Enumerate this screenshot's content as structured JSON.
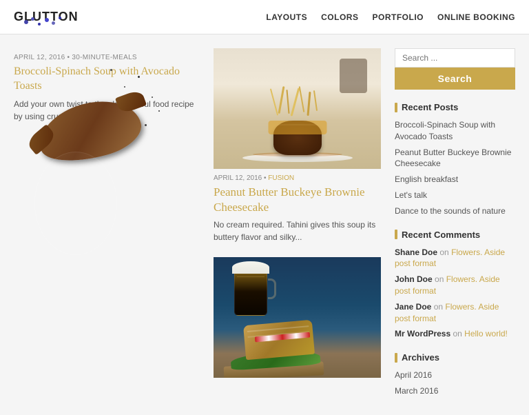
{
  "header": {
    "logo": "GLUTTON",
    "nav": [
      {
        "label": "LAYOUTS",
        "href": "#"
      },
      {
        "label": "COLORS",
        "href": "#"
      },
      {
        "label": "PORTFOLIO",
        "href": "#"
      },
      {
        "label": "ONLINE BOOKING",
        "href": "#"
      }
    ]
  },
  "featured_post": {
    "meta": "APRIL 12, 2016 • 30-MINUTE-MEALS",
    "title": "Broccoli-Spinach Soup with Avocado Toasts",
    "excerpt": "Add your own twist to the classic soul food recipe by using crunchy wa..."
  },
  "center_posts": [
    {
      "id": "post-1",
      "meta_date": "APRIL 12, 2016",
      "meta_category": "FUSION",
      "title": "Peanut Butter Buckeye Brownie Cheesecake",
      "excerpt": "No cream required. Tahini gives this soup its buttery flavor and silky..."
    },
    {
      "id": "post-2",
      "meta_date": "",
      "meta_category": "",
      "title": "",
      "excerpt": ""
    }
  ],
  "sidebar": {
    "search_placeholder": "Search ...",
    "search_button": "Search",
    "recent_posts_title": "Recent Posts",
    "recent_posts": [
      "Broccoli-Spinach Soup with Avocado Toasts",
      "Peanut Butter Buckeye Brownie Cheesecake",
      "English breakfast",
      "Let's talk",
      "Dance to the sounds of nature"
    ],
    "recent_comments_title": "Recent Comments",
    "recent_comments": [
      {
        "author": "Shane Doe",
        "on": "on",
        "link": "Flowers. Aside post format"
      },
      {
        "author": "John Doe",
        "on": "on",
        "link": "Flowers. Aside post format"
      },
      {
        "author": "Jane Doe",
        "on": "on",
        "link": "Flowers. Aside post format"
      },
      {
        "author": "Mr WordPress",
        "on": "on",
        "link": "Hello world!"
      }
    ],
    "archives_title": "Archives",
    "archives": [
      "April 2016",
      "March 2016"
    ]
  }
}
